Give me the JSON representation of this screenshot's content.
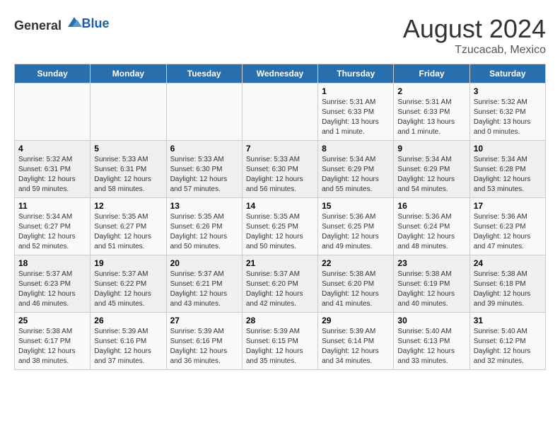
{
  "header": {
    "logo_general": "General",
    "logo_blue": "Blue",
    "main_title": "August 2024",
    "subtitle": "Tzucacab, Mexico"
  },
  "days_of_week": [
    "Sunday",
    "Monday",
    "Tuesday",
    "Wednesday",
    "Thursday",
    "Friday",
    "Saturday"
  ],
  "weeks": [
    [
      {
        "day": "",
        "info": ""
      },
      {
        "day": "",
        "info": ""
      },
      {
        "day": "",
        "info": ""
      },
      {
        "day": "",
        "info": ""
      },
      {
        "day": "1",
        "info": "Sunrise: 5:31 AM\nSunset: 6:33 PM\nDaylight: 13 hours\nand 1 minute."
      },
      {
        "day": "2",
        "info": "Sunrise: 5:31 AM\nSunset: 6:33 PM\nDaylight: 13 hours\nand 1 minute."
      },
      {
        "day": "3",
        "info": "Sunrise: 5:32 AM\nSunset: 6:32 PM\nDaylight: 13 hours\nand 0 minutes."
      }
    ],
    [
      {
        "day": "4",
        "info": "Sunrise: 5:32 AM\nSunset: 6:31 PM\nDaylight: 12 hours\nand 59 minutes."
      },
      {
        "day": "5",
        "info": "Sunrise: 5:33 AM\nSunset: 6:31 PM\nDaylight: 12 hours\nand 58 minutes."
      },
      {
        "day": "6",
        "info": "Sunrise: 5:33 AM\nSunset: 6:30 PM\nDaylight: 12 hours\nand 57 minutes."
      },
      {
        "day": "7",
        "info": "Sunrise: 5:33 AM\nSunset: 6:30 PM\nDaylight: 12 hours\nand 56 minutes."
      },
      {
        "day": "8",
        "info": "Sunrise: 5:34 AM\nSunset: 6:29 PM\nDaylight: 12 hours\nand 55 minutes."
      },
      {
        "day": "9",
        "info": "Sunrise: 5:34 AM\nSunset: 6:29 PM\nDaylight: 12 hours\nand 54 minutes."
      },
      {
        "day": "10",
        "info": "Sunrise: 5:34 AM\nSunset: 6:28 PM\nDaylight: 12 hours\nand 53 minutes."
      }
    ],
    [
      {
        "day": "11",
        "info": "Sunrise: 5:34 AM\nSunset: 6:27 PM\nDaylight: 12 hours\nand 52 minutes."
      },
      {
        "day": "12",
        "info": "Sunrise: 5:35 AM\nSunset: 6:27 PM\nDaylight: 12 hours\nand 51 minutes."
      },
      {
        "day": "13",
        "info": "Sunrise: 5:35 AM\nSunset: 6:26 PM\nDaylight: 12 hours\nand 50 minutes."
      },
      {
        "day": "14",
        "info": "Sunrise: 5:35 AM\nSunset: 6:25 PM\nDaylight: 12 hours\nand 50 minutes."
      },
      {
        "day": "15",
        "info": "Sunrise: 5:36 AM\nSunset: 6:25 PM\nDaylight: 12 hours\nand 49 minutes."
      },
      {
        "day": "16",
        "info": "Sunrise: 5:36 AM\nSunset: 6:24 PM\nDaylight: 12 hours\nand 48 minutes."
      },
      {
        "day": "17",
        "info": "Sunrise: 5:36 AM\nSunset: 6:23 PM\nDaylight: 12 hours\nand 47 minutes."
      }
    ],
    [
      {
        "day": "18",
        "info": "Sunrise: 5:37 AM\nSunset: 6:23 PM\nDaylight: 12 hours\nand 46 minutes."
      },
      {
        "day": "19",
        "info": "Sunrise: 5:37 AM\nSunset: 6:22 PM\nDaylight: 12 hours\nand 45 minutes."
      },
      {
        "day": "20",
        "info": "Sunrise: 5:37 AM\nSunset: 6:21 PM\nDaylight: 12 hours\nand 43 minutes."
      },
      {
        "day": "21",
        "info": "Sunrise: 5:37 AM\nSunset: 6:20 PM\nDaylight: 12 hours\nand 42 minutes."
      },
      {
        "day": "22",
        "info": "Sunrise: 5:38 AM\nSunset: 6:20 PM\nDaylight: 12 hours\nand 41 minutes."
      },
      {
        "day": "23",
        "info": "Sunrise: 5:38 AM\nSunset: 6:19 PM\nDaylight: 12 hours\nand 40 minutes."
      },
      {
        "day": "24",
        "info": "Sunrise: 5:38 AM\nSunset: 6:18 PM\nDaylight: 12 hours\nand 39 minutes."
      }
    ],
    [
      {
        "day": "25",
        "info": "Sunrise: 5:38 AM\nSunset: 6:17 PM\nDaylight: 12 hours\nand 38 minutes."
      },
      {
        "day": "26",
        "info": "Sunrise: 5:39 AM\nSunset: 6:16 PM\nDaylight: 12 hours\nand 37 minutes."
      },
      {
        "day": "27",
        "info": "Sunrise: 5:39 AM\nSunset: 6:16 PM\nDaylight: 12 hours\nand 36 minutes."
      },
      {
        "day": "28",
        "info": "Sunrise: 5:39 AM\nSunset: 6:15 PM\nDaylight: 12 hours\nand 35 minutes."
      },
      {
        "day": "29",
        "info": "Sunrise: 5:39 AM\nSunset: 6:14 PM\nDaylight: 12 hours\nand 34 minutes."
      },
      {
        "day": "30",
        "info": "Sunrise: 5:40 AM\nSunset: 6:13 PM\nDaylight: 12 hours\nand 33 minutes."
      },
      {
        "day": "31",
        "info": "Sunrise: 5:40 AM\nSunset: 6:12 PM\nDaylight: 12 hours\nand 32 minutes."
      }
    ]
  ]
}
